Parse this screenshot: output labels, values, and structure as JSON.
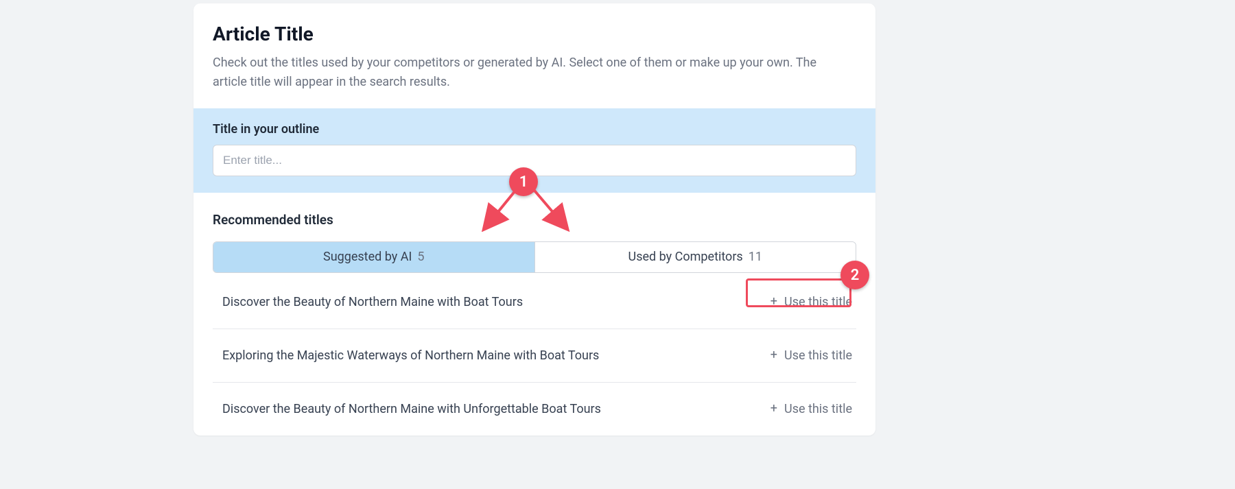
{
  "header": {
    "title": "Article Title",
    "description": "Check out the titles used by your competitors or generated by AI. Select one of them or make up your own. The article title will appear in the search results."
  },
  "outline": {
    "label": "Title in your outline",
    "placeholder": "Enter title..."
  },
  "recommended": {
    "heading": "Recommended titles",
    "tabs": [
      {
        "label": "Suggested by AI",
        "count": "5",
        "active": true
      },
      {
        "label": "Used by Competitors",
        "count": "11",
        "active": false
      }
    ],
    "use_label": "Use this title",
    "items": [
      "Discover the Beauty of Northern Maine with Boat Tours",
      "Exploring the Majestic Waterways of Northern Maine with Boat Tours",
      "Discover the Beauty of Northern Maine with Unforgettable Boat Tours"
    ]
  },
  "annotations": {
    "badge1": "1",
    "badge2": "2",
    "color": "#ef4a5c"
  }
}
